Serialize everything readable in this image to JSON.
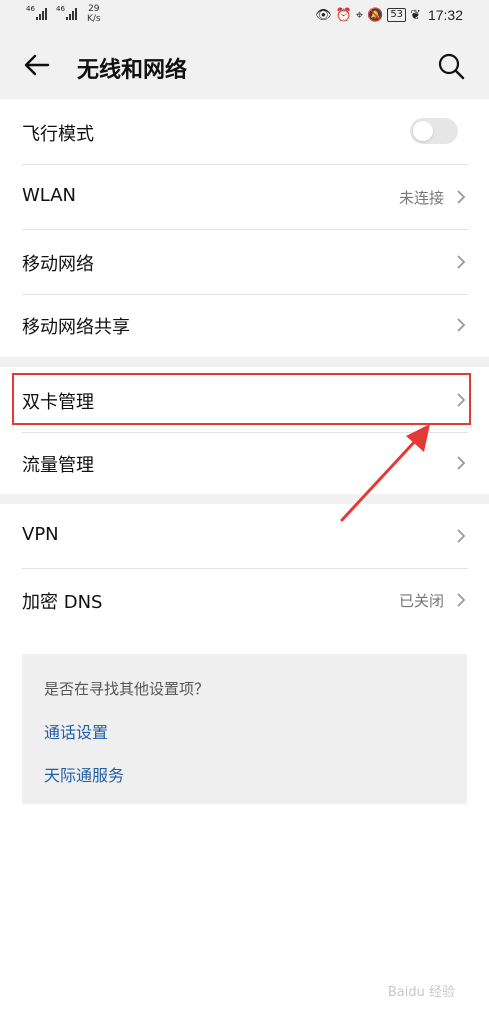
{
  "status_bar": {
    "sim1": "46",
    "sim2": "46",
    "speed_value": "29",
    "speed_unit": "K/s",
    "battery": "53",
    "time": "17:32"
  },
  "header": {
    "title": "无线和网络"
  },
  "rows": [
    {
      "label": "飞行模式",
      "value": "",
      "toggle_on": false
    },
    {
      "label": "WLAN",
      "value": "未连接"
    },
    {
      "label": "移动网络",
      "value": ""
    },
    {
      "label": "移动网络共享",
      "value": ""
    },
    {
      "label": "双卡管理",
      "value": ""
    },
    {
      "label": "流量管理",
      "value": ""
    },
    {
      "label": "VPN",
      "value": ""
    },
    {
      "label": "加密 DNS",
      "value": "已关闭"
    }
  ],
  "suggestions": {
    "question": "是否在寻找其他设置项？",
    "links": [
      "通话设置",
      "天际通服务"
    ]
  },
  "colors": {
    "accent_link": "#1f5fa8",
    "highlight": "#e53935"
  },
  "watermark": "Baidu 经验"
}
